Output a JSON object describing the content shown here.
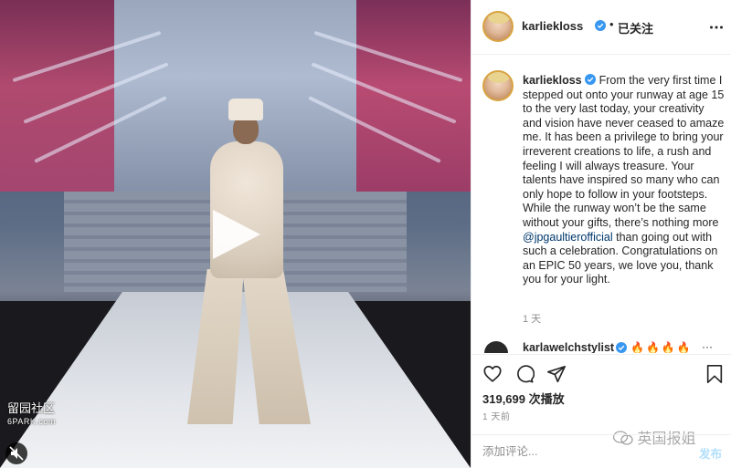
{
  "video": {
    "watermark_line1": "留园社区",
    "watermark_line2": "6PARK.com"
  },
  "header": {
    "username": "karlieklosskarlieklosskarliekloss",
    "follow_status": "已关注",
    "separator": "•"
  },
  "caption": {
    "username": "karliekloss",
    "text_part1": " From the very first time I stepped out onto your runway at age 15 to the very last today, your creativity and vision have never ceased to amaze me. It has been a privilege to bring your irreverent creations to life, a rush and feeling I will always treasure. Your talents have inspired so many who can only hope to follow in your footsteps. While the runway won’t be the same without your gifts, there’s nothing more ",
    "mention": "@jpgaultierofficial",
    "text_part2": " than going out with such a celebration. Congratulations on an EPIC 50 years, we love you, thank you for your light.",
    "time": "1 天"
  },
  "comment": {
    "username": "karlawelchstylist",
    "emoji": "🔥🔥🔥🔥",
    "more": "···"
  },
  "actions": {
    "likes": "319,699 次播放",
    "post_time": "1 天前"
  },
  "watermark_wechat": "英国报姐",
  "comment_bar": {
    "placeholder": "添加评论...",
    "post_label": "发布"
  },
  "colors": {
    "verified": "#3897f0",
    "mention": "#00376b",
    "post_button": "#b2dffc",
    "muted_text": "#8e8e8e"
  },
  "icons": [
    "play-icon",
    "mute-icon",
    "verified-icon",
    "more-icon",
    "heart-icon",
    "comment-icon",
    "share-icon",
    "bookmark-icon",
    "wechat-icon"
  ]
}
